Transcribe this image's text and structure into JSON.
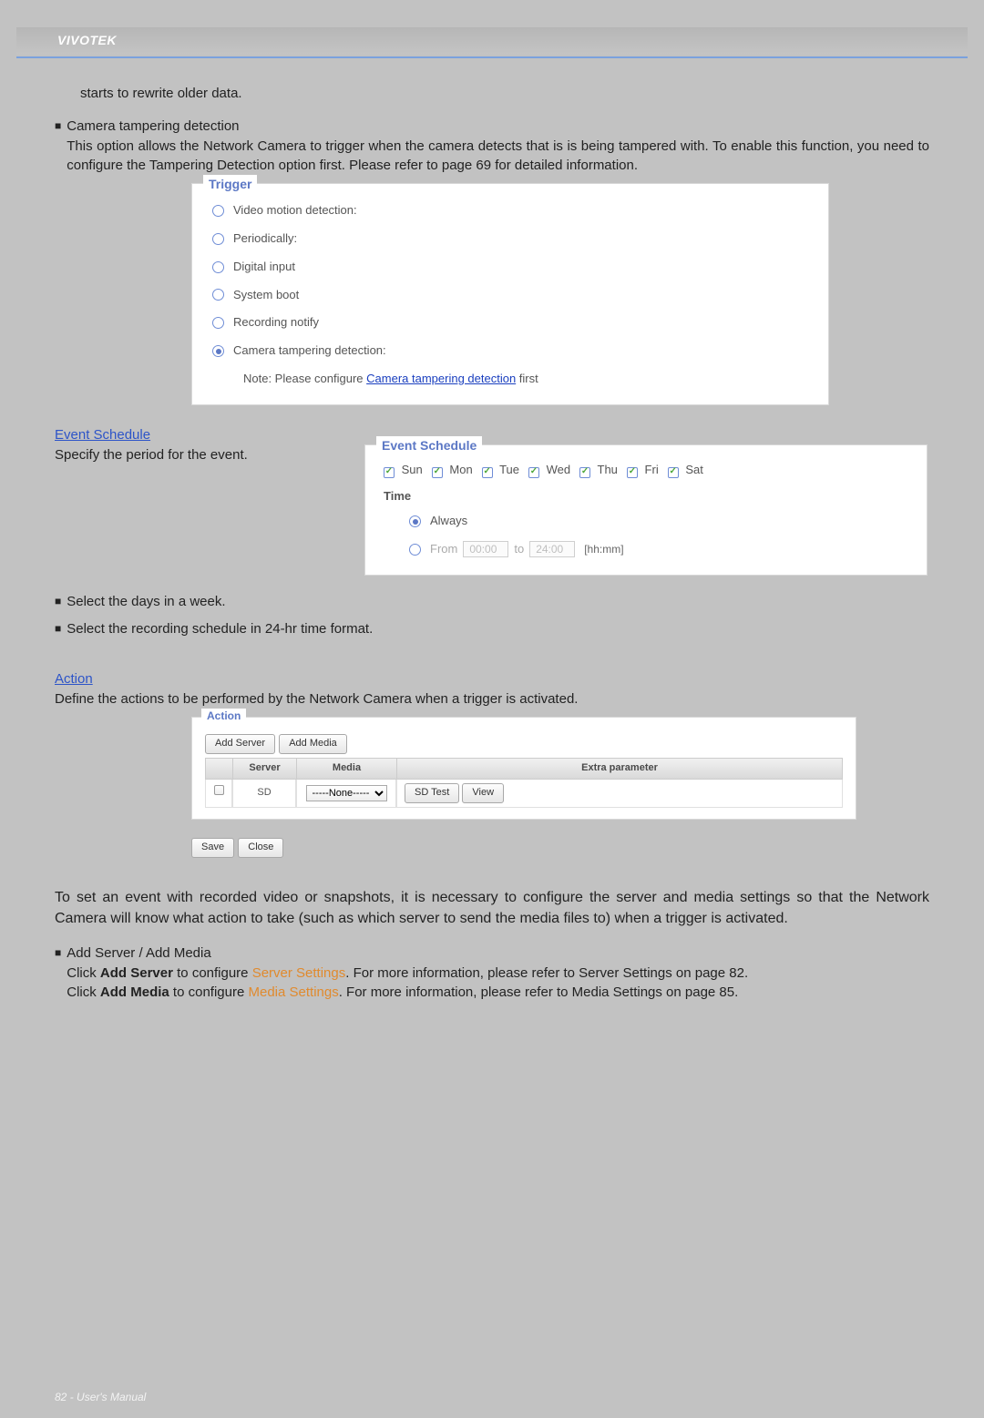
{
  "header": {
    "brand": "VIVOTEK"
  },
  "body": {
    "resume_line": "starts to rewrite older data.",
    "tamper_title": "Camera tampering detection",
    "tamper_desc": "This option allows the Network Camera to trigger when the camera detects that is is being tampered with. To enable this function, you need to configure the Tampering Detection option first. Please refer to page 69 for detailed information."
  },
  "trigger_panel": {
    "legend": "Trigger",
    "options": {
      "video": "Video motion detection:",
      "periodically": "Periodically:",
      "digital": "Digital input",
      "boot": "System boot",
      "recnotify": "Recording notify",
      "tamper": "Camera tampering detection:"
    },
    "note_prefix": "Note: Please configure ",
    "note_link": "Camera tampering detection",
    "note_suffix": " first"
  },
  "schedule": {
    "heading": "Event Schedule",
    "intro": "Specify the period for the event.",
    "legend": "Event Schedule",
    "days": {
      "sun": "Sun",
      "mon": "Mon",
      "tue": "Tue",
      "wed": "Wed",
      "thu": "Thu",
      "fri": "Fri",
      "sat": "Sat"
    },
    "check_glyph": "✓",
    "time_label": "Time",
    "always": "Always",
    "from_label": "From",
    "from_val": "00:00",
    "to_label": "to",
    "to_val": "24:00",
    "hhmm": "[hh:mm]"
  },
  "bullets2": {
    "days": "Select the days in a week.",
    "sched": "Select the recording schedule in 24-hr time format."
  },
  "action": {
    "heading": "Action",
    "intro": "Define the actions to be performed by the Network Camera when a trigger is activated.",
    "legend": "Action",
    "add_server": "Add Server",
    "add_media": "Add Media",
    "th_server": "Server",
    "th_media": "Media",
    "th_extra": "Extra parameter",
    "row_server": "SD",
    "media_none": "-----None-----",
    "sd_test": "SD Test",
    "view": "View",
    "save": "Save",
    "close": "Close",
    "para": "To set an event with recorded video or snapshots, it is necessary to configure the server and media settings so that the Network Camera will know what action to take (such as which server to send the media files to) when a trigger is activated.",
    "add_title": "Add Server / Add Media",
    "line1a": "Click ",
    "line1b": "Add Server",
    "line1c": " to configure ",
    "line1d": "Server Settings",
    "line1e": ". For more information, please refer to Server Settings on page 82.",
    "line2a": "Click ",
    "line2b": "Add Media",
    "line2c": " to configure ",
    "line2d": "Media Settings",
    "line2e": ". For more information, please refer to Media Settings on page 85."
  },
  "footer": {
    "page": "82",
    "sep": " - ",
    "title": "User's Manual"
  }
}
